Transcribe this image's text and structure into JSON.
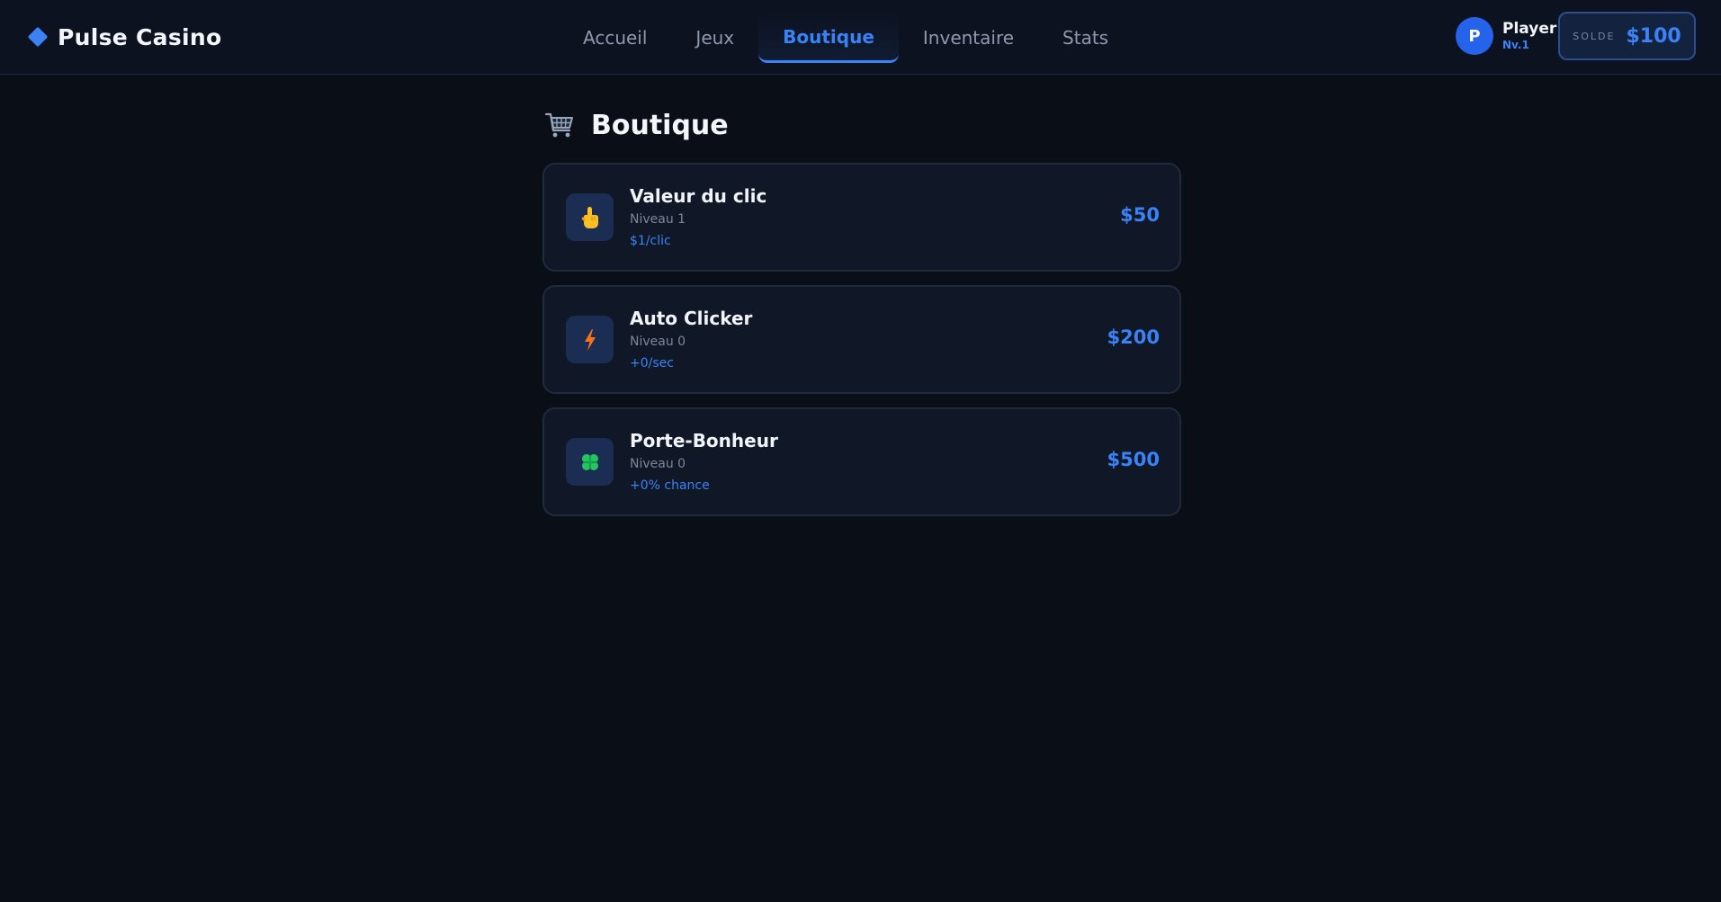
{
  "app": {
    "name": "Pulse Casino"
  },
  "nav": {
    "tabs": [
      {
        "label": "Accueil",
        "active": false
      },
      {
        "label": "Jeux",
        "active": false
      },
      {
        "label": "Boutique",
        "active": true
      },
      {
        "label": "Inventaire",
        "active": false
      },
      {
        "label": "Stats",
        "active": false
      }
    ]
  },
  "user": {
    "initial": "P",
    "name": "Player",
    "level": "Nv.1"
  },
  "balance": {
    "label": "SOLDE",
    "value": "$100"
  },
  "page": {
    "title": "Boutique",
    "icon": "shopping-cart-icon"
  },
  "shop": {
    "items": [
      {
        "name": "Valeur du clic",
        "level": "Niveau 1",
        "effect": "$1/clic",
        "price": "$50",
        "icon": "pointing-hand-icon"
      },
      {
        "name": "Auto Clicker",
        "level": "Niveau 0",
        "effect": "+0/sec",
        "price": "$200",
        "icon": "lightning-icon"
      },
      {
        "name": "Porte-Bonheur",
        "level": "Niveau 0",
        "effect": "+0% chance",
        "price": "$500",
        "icon": "four-leaf-clover-icon"
      }
    ]
  },
  "colors": {
    "accent": "#3b82f6",
    "background": "#0a0e17",
    "card": "#101827",
    "lightning": "#f97316",
    "clover": "#22c55e",
    "hand": "#fbbf24"
  }
}
